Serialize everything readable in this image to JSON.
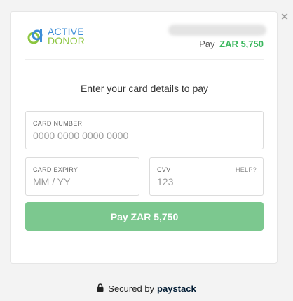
{
  "close_icon": "close-icon",
  "header": {
    "logo": {
      "line1": "ACTIVE",
      "line2": "DONOR",
      "colors": {
        "blue": "#3d8dd6",
        "green": "#8cc63f"
      }
    },
    "pay_prefix": "Pay",
    "pay_amount": "ZAR 5,750"
  },
  "instruction": "Enter your card details to pay",
  "fields": {
    "card_number": {
      "label": "CARD NUMBER",
      "placeholder": "0000 0000 0000 0000",
      "value": ""
    },
    "card_expiry": {
      "label": "CARD EXPIRY",
      "placeholder": "MM / YY",
      "value": ""
    },
    "cvv": {
      "label": "CVV",
      "placeholder": "123",
      "value": "",
      "help": "HELP?"
    }
  },
  "pay_button": {
    "label": "Pay ZAR 5,750",
    "color": "#7cc88f"
  },
  "footer": {
    "secured_text": "Secured by",
    "brand": "paystack",
    "icon": "lock-icon"
  },
  "colors": {
    "amount": "#3bb75e",
    "background": "#f3f3f3"
  }
}
